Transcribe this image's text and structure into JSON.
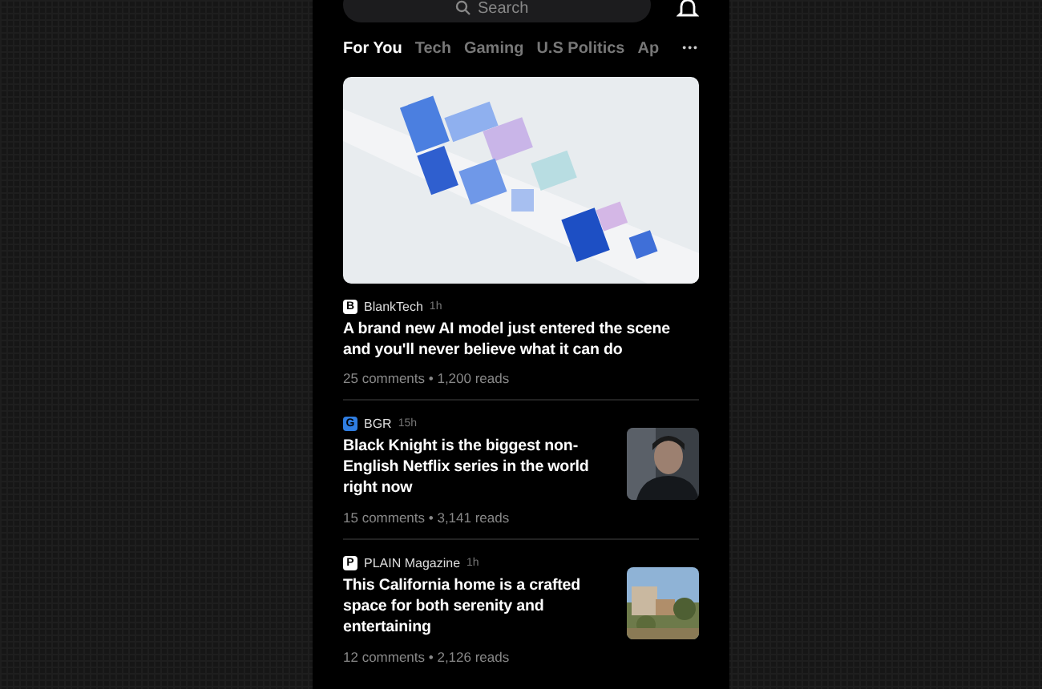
{
  "search": {
    "placeholder": "Search"
  },
  "tabs": [
    {
      "label": "For You",
      "selected": true
    },
    {
      "label": "Tech",
      "selected": false
    },
    {
      "label": "Gaming",
      "selected": false
    },
    {
      "label": "U.S Politics",
      "selected": false
    },
    {
      "label": "Ap",
      "selected": false
    }
  ],
  "more": "•••",
  "articles": [
    {
      "kind": "hero",
      "logo": "B",
      "color": "#ffffff",
      "source": "BlankTech",
      "time": "1h",
      "title": "A brand new AI model just entered the scene and you'll never believe what it can do",
      "meta": "25 comments • 1,200 reads"
    },
    {
      "kind": "person",
      "logo": "G",
      "color": "#2f7de1",
      "source": "BGR",
      "time": "15h",
      "title": "Black Knight is the biggest non-English Netflix series in the world right now",
      "meta": "15 comments • 3,141 reads"
    },
    {
      "kind": "house",
      "logo": "P",
      "color": "#ffffff",
      "source": "PLAIN Magazine",
      "time": "1h",
      "title": "This California home is a crafted space for both serenity and entertaining",
      "meta": "12 comments • 2,126 reads"
    }
  ]
}
